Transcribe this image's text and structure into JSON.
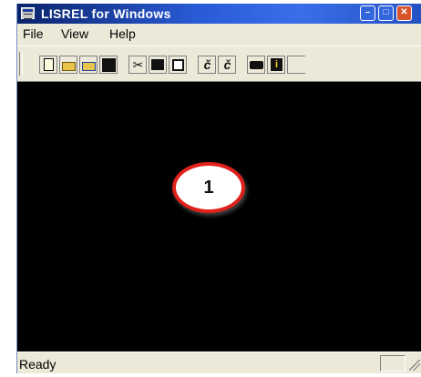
{
  "window": {
    "title": "LISREL for Windows",
    "title_bar_colors": {
      "start": "#0a246a",
      "end": "#3a6ee8"
    },
    "controls": [
      "minimize-icon",
      "maximize-icon",
      "close-icon"
    ]
  },
  "menu": {
    "items": [
      {
        "label": "File"
      },
      {
        "label": "View"
      },
      {
        "label": "Help"
      }
    ]
  },
  "toolbar": {
    "tools": [
      {
        "icon": "new-document-icon"
      },
      {
        "icon": "open-folder-icon"
      },
      {
        "icon": "open-folder-alt-icon"
      },
      {
        "icon": "save-icon"
      },
      {
        "icon": "cut-icon"
      },
      {
        "icon": "copy-icon"
      },
      {
        "icon": "paste-icon"
      },
      {
        "icon": "run-icon"
      },
      {
        "icon": "run-alt-icon"
      },
      {
        "icon": "print-icon"
      },
      {
        "icon": "info-icon"
      }
    ]
  },
  "workspace": {
    "background": "#000000",
    "callout": {
      "label": "1",
      "border_color": "#e0201a"
    }
  },
  "status_bar": {
    "text": "Ready"
  }
}
